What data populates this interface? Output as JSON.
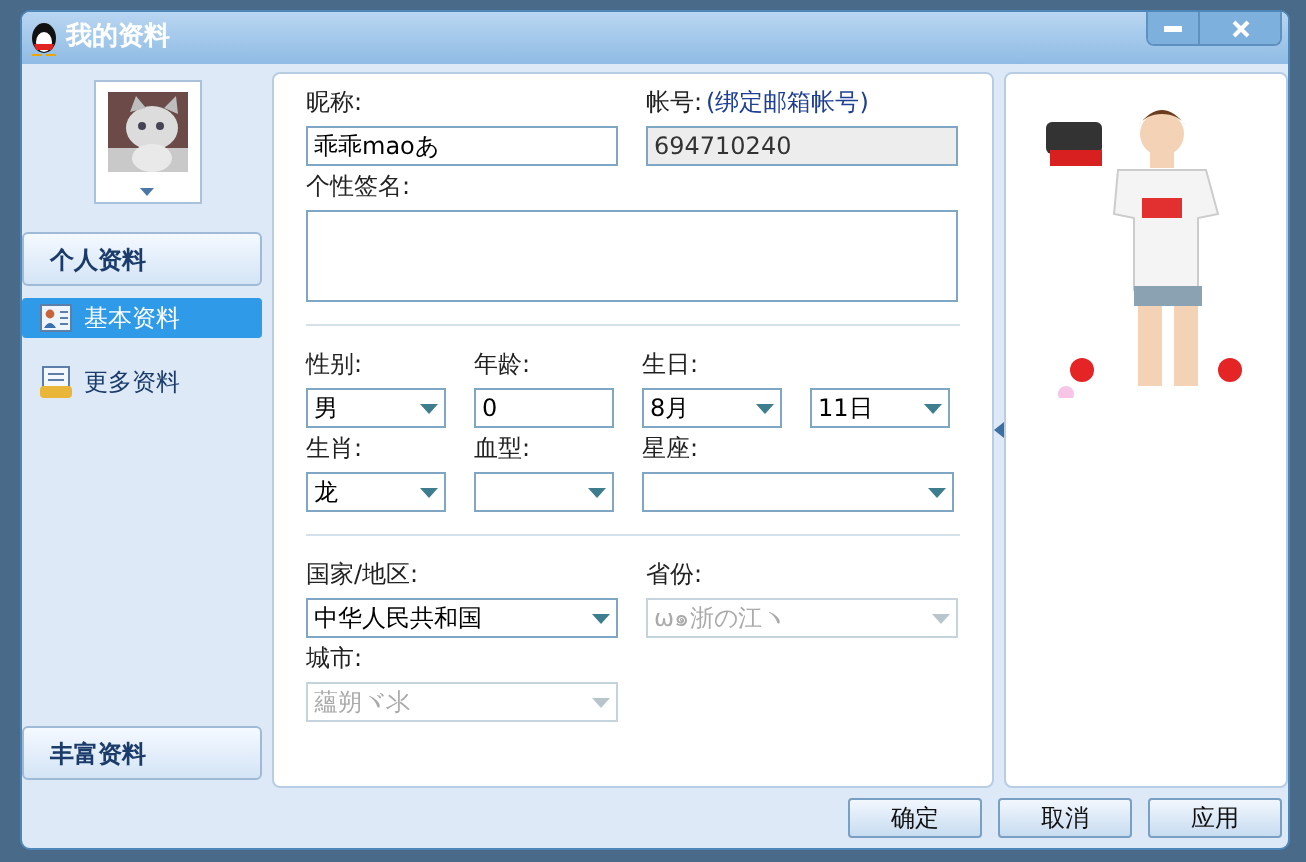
{
  "window": {
    "title": "我的资料"
  },
  "sidebar": {
    "sections": [
      {
        "label": "个人资料",
        "items": [
          {
            "label": "基本资料",
            "selected": true
          },
          {
            "label": "更多资料",
            "selected": false
          }
        ]
      }
    ],
    "footer": "丰富资料"
  },
  "form": {
    "sections": [
      {
        "rows": [
          [
            {
              "label": "昵称:",
              "kind": "text",
              "value": "乖乖maoあ"
            },
            {
              "label": "帐号:",
              "hint": "(绑定邮箱帐号)",
              "kind": "readonly",
              "value": "694710240"
            }
          ],
          [
            {
              "label": "个性签名:",
              "kind": "textarea"
            }
          ]
        ]
      },
      {
        "rows": [
          [
            {
              "label": "性别:",
              "kind": "select",
              "value": "男"
            },
            {
              "label": "年龄:",
              "kind": "text",
              "value": "0"
            },
            {
              "label": "生日:",
              "kind": "select",
              "value": "8月"
            },
            {
              "kind": "select",
              "value": "11日"
            }
          ],
          [
            {
              "label": "生肖:",
              "kind": "select",
              "value": "龙"
            },
            {
              "label": "血型:",
              "kind": "select"
            },
            {
              "label": "星座:",
              "kind": "select"
            }
          ]
        ]
      },
      {
        "rows": [
          [
            {
              "label": "国家/地区:",
              "kind": "select",
              "value": "中华人民共和国"
            },
            {
              "label": "省份:",
              "kind": "disabled",
              "value": "ω๑浙の江ヽ"
            }
          ],
          [
            {
              "label": "城市:",
              "kind": "disabled",
              "value": "蘊朔ヾ氺"
            }
          ]
        ]
      }
    ]
  },
  "buttons": [
    "确定",
    "取消",
    "应用"
  ]
}
